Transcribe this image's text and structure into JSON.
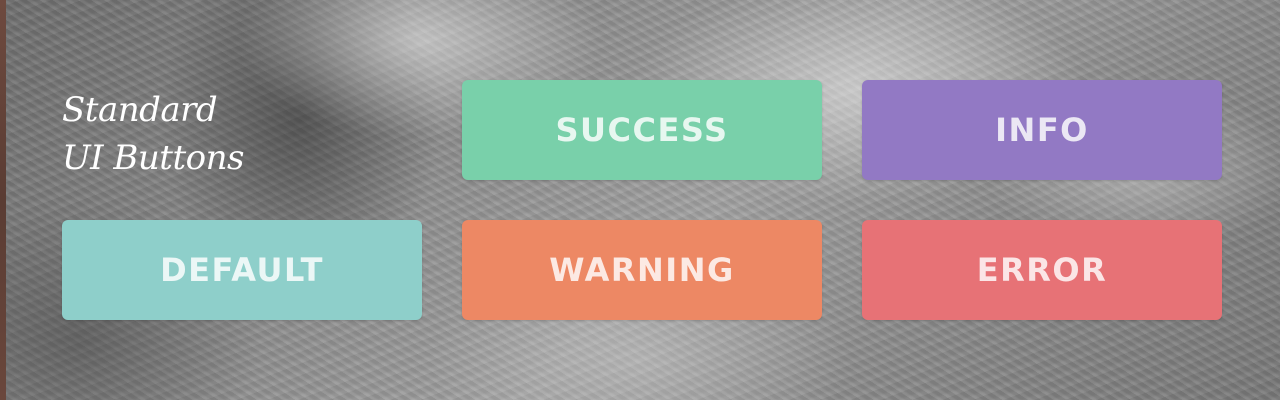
{
  "heading": {
    "line1": "Standard",
    "line2": "UI Buttons"
  },
  "buttons": {
    "success": {
      "label": "SUCCESS",
      "color": "#79d0aa"
    },
    "info": {
      "label": "INFO",
      "color": "#9279c4"
    },
    "default": {
      "label": "DEFAULT",
      "color": "#8ecfca"
    },
    "warning": {
      "label": "WARNING",
      "color": "#ed8864"
    },
    "error": {
      "label": "ERROR",
      "color": "#e77276"
    }
  },
  "background": {
    "texture": "grey marble"
  }
}
